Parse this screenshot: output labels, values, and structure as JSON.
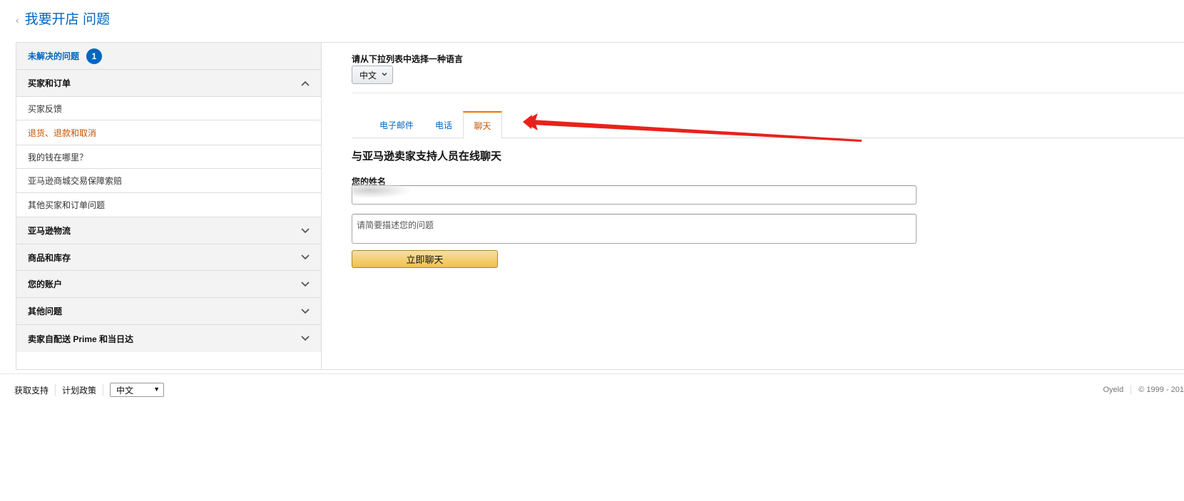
{
  "header": {
    "back_glyph": "‹",
    "title": "我要开店 问题"
  },
  "sidebar": {
    "unresolved": {
      "label": "未解决的问题",
      "count": "1"
    },
    "groups": [
      {
        "label": "买家和订单",
        "expanded": true
      },
      {
        "label": "亚马逊物流",
        "expanded": false
      },
      {
        "label": "商品和库存",
        "expanded": false
      },
      {
        "label": "您的账户",
        "expanded": false
      },
      {
        "label": "其他问题",
        "expanded": false
      },
      {
        "label": "卖家自配送 Prime 和当日达",
        "expanded": false
      }
    ],
    "subitems": [
      {
        "label": "买家反馈",
        "active": false
      },
      {
        "label": "退货、退款和取消",
        "active": true
      },
      {
        "label": "我的钱在哪里？",
        "active": false
      },
      {
        "label": "亚马逊商城交易保障索赔",
        "active": false
      },
      {
        "label": "其他买家和订单问题",
        "active": false
      }
    ]
  },
  "content": {
    "language_label": "请从下拉列表中选择一种语言",
    "language_value": "中文",
    "tabs": [
      {
        "label": "电子邮件",
        "active": false
      },
      {
        "label": "电话",
        "active": false
      },
      {
        "label": "聊天",
        "active": true
      }
    ],
    "chat_heading": "与亚马逊卖家支持人员在线聊天",
    "name_label": "您的姓名",
    "name_value": "",
    "description_placeholder": "请简要描述您的问题",
    "chat_button": "立即聊天"
  },
  "footer": {
    "links": [
      "获取支持",
      "计划政策"
    ],
    "language_value": "中文",
    "right_items": [
      "Oyeld",
      "© 1999 - 201"
    ]
  },
  "colors": {
    "link_blue": "#0066c0",
    "active_orange": "#c45500",
    "tab_accent": "#e77600",
    "button_gold": "#f0c14b",
    "arrow_red": "#e8221b"
  }
}
